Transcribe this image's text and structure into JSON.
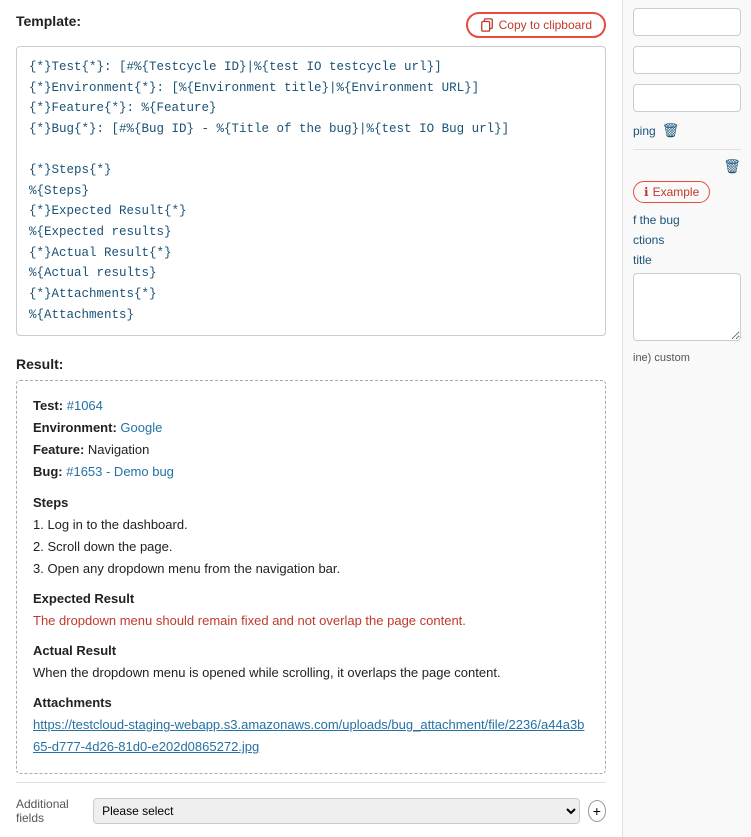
{
  "template": {
    "label": "Template:",
    "copy_button": "Copy to clipboard",
    "lines": [
      "{*}Test{*}: [#%{Testcycle ID}|%{test IO testcycle url}]",
      "{*}Environment{*}: [%{Environment title}|%{Environment URL}]",
      "{*}Feature{*}: %{Feature}",
      "{*}Bug{*}: [#%{Bug ID} - %{Title of the bug}|%{test IO Bug url}]",
      "",
      "{*}Steps{*}",
      "%{Steps}",
      "{*}Expected Result{*}",
      "%{Expected results}",
      "{*}Actual Result{*}",
      "%{Actual results}",
      "{*}Attachments{*}",
      "%{Attachments}"
    ]
  },
  "result": {
    "label": "Result:",
    "test_label": "Test:",
    "test_value": "#1064",
    "environment_label": "Environment:",
    "environment_value": "Google",
    "feature_label": "Feature:",
    "feature_value": "Navigation",
    "bug_label": "Bug:",
    "bug_value": "#1653 - Demo bug",
    "steps_heading": "Steps",
    "steps": [
      "1. Log in to the dashboard.",
      "2. Scroll down the page.",
      "3. Open any dropdown menu from the navigation bar."
    ],
    "expected_heading": "Expected Result",
    "expected_text": "The dropdown menu should remain fixed and not overlap the page content.",
    "actual_heading": "Actual Result",
    "actual_text": "When the dropdown menu is opened while scrolling, it overlaps the page content.",
    "attachments_heading": "Attachments",
    "attachment_url": "https://testcloud-staging-webapp.s3.amazonaws.com/uploads/bug_attachment/file/2236/a44a3b65-d777-4d26-81d0-e202d0865272.jpg"
  },
  "right_panel": {
    "dropdown1_placeholder": "",
    "dropdown2_placeholder": "",
    "dropdown3_placeholder": "",
    "mapping_label": "ping",
    "example_button": "Example",
    "items": [
      "f the bug",
      "ctions",
      "title"
    ],
    "textarea_placeholder": "",
    "custom_label": "ine) custom",
    "additional_fields_label": "Additional fields",
    "additional_fields_placeholder": "Please select"
  },
  "icons": {
    "copy": "⧉",
    "trash": "🗑",
    "info": "ℹ",
    "chevron_down": "▾",
    "plus": "+"
  }
}
